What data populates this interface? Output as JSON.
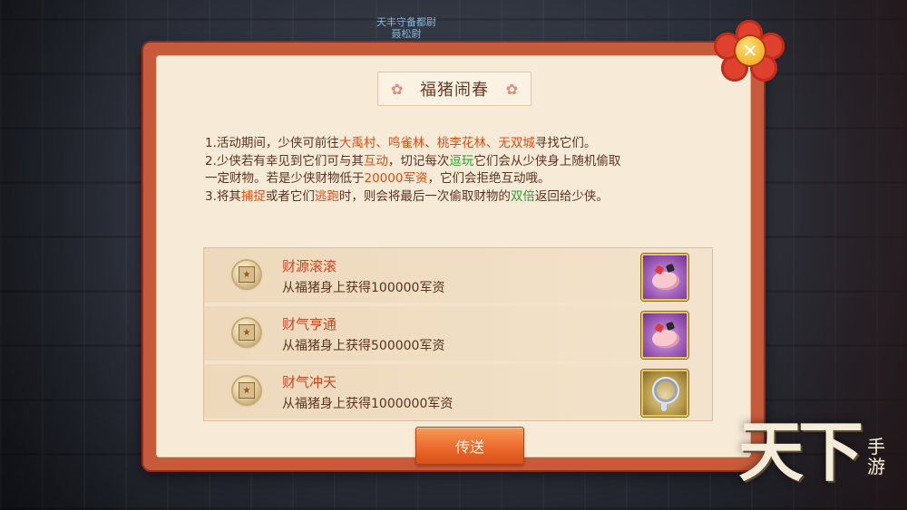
{
  "background": {
    "npc_label_line1": "天丰守备都尉",
    "npc_label_line2": "聂松尉"
  },
  "dialog": {
    "title": "福猪闹春",
    "rules": [
      [
        {
          "t": "1.活动期间，少侠可前往",
          "c": ""
        },
        {
          "t": "大禹村、鸣雀林、桃李花林、无双城",
          "c": "red"
        },
        {
          "t": "寻找它们。",
          "c": ""
        }
      ],
      [
        {
          "t": "2.少侠若有幸见到它们可与其",
          "c": ""
        },
        {
          "t": "互动",
          "c": "red"
        },
        {
          "t": "，切记每次",
          "c": ""
        },
        {
          "t": "逗玩",
          "c": "green"
        },
        {
          "t": "它们会从少侠身上随机偷取",
          "c": ""
        }
      ],
      [
        {
          "t": "一定财物。若是少侠财物低于",
          "c": ""
        },
        {
          "t": "20000军资",
          "c": "red"
        },
        {
          "t": "，它们会拒绝互动哦。",
          "c": ""
        }
      ],
      [
        {
          "t": "3.将其",
          "c": ""
        },
        {
          "t": "捕捉",
          "c": "red"
        },
        {
          "t": "或者它们",
          "c": ""
        },
        {
          "t": "逃跑",
          "c": "red"
        },
        {
          "t": "时，则会将最后一次偷取财物的",
          "c": ""
        },
        {
          "t": "双倍",
          "c": "green"
        },
        {
          "t": "返回给少侠。",
          "c": ""
        }
      ]
    ],
    "rewards": [
      {
        "title": "财源滚滚",
        "desc": "从福猪身上获得100000军资",
        "icon": "pig-card-icon",
        "frame": "purple"
      },
      {
        "title": "财气亨通",
        "desc": "从福猪身上获得500000军资",
        "icon": "pig-card-icon",
        "frame": "purple"
      },
      {
        "title": "财气冲天",
        "desc": "从福猪身上获得1000000军资",
        "icon": "dreamcatcher-icon",
        "frame": "gold"
      }
    ],
    "send_button": "传送",
    "close_icon": "close-icon"
  },
  "logo": {
    "main": "天下",
    "sub": "手游"
  },
  "colors": {
    "panel_border": "#c75a3a",
    "panel_bg": "#f7ead6",
    "highlight_red": "#e24d15",
    "highlight_green": "#2aa234",
    "button": "#ec6a2c"
  }
}
